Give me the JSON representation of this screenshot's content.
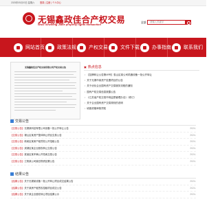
{
  "topbar": {
    "date": "2025年05月03日 星期六",
    "login": "登录 | 注册 | 个人中心"
  },
  "header": {
    "logo_title": "无锡鑫政佳合产权交易",
    "logo_subtitle": "Wuxi Xinzheng Jiahe property rights transaction",
    "search_label": "全部",
    "search_placeholder": "请输入关键字"
  },
  "nav": {
    "items": [
      {
        "label": "网站首页",
        "icon": "home-icon"
      },
      {
        "label": "政策法规",
        "icon": "document-icon"
      },
      {
        "label": "产权交易",
        "icon": "exchange-icon"
      },
      {
        "label": "文件下载",
        "icon": "download-icon"
      },
      {
        "label": "办事指南",
        "icon": "guide-icon"
      },
      {
        "label": "联系我们",
        "icon": "contact-icon"
      }
    ]
  },
  "feature": {
    "heading": "无锡鑫政佳合产权交易有限公司产权交易公告"
  },
  "hot": {
    "title": "热点信息",
    "items": [
      "【挂牌转让公告第49号】惠山区某公司机器设备一批公开转让",
      "关于无锡市某资产处置项目的公告",
      "关于优化企业国有资产交易服务流程的通知",
      "国有产权交易信息披露公告",
      "《江苏省产权交易市场监督管理办法》（修订）",
      "关于企业国有资产交易规则的说明",
      "填报资格审核须知"
    ]
  },
  "sections": [
    {
      "title": "交易公告",
      "rows": [
        {
          "tag": "【交易公告】",
          "title": "无锡某科技有限公司设备一批公开转让公告",
          "date": "2024-"
        },
        {
          "tag": "【交易公告】",
          "title": "锡山区某资产整体转让项目交易公告",
          "date": "2024-"
        },
        {
          "tag": "【交易公告】",
          "title": "新吴区某房产租赁权公开招租公告",
          "date": "2024-"
        },
        {
          "tag": "【交易公告】",
          "title": "滨湖区某企业股权转让交易公告",
          "date": "2024-"
        },
        {
          "tag": "【交易公告】",
          "title": "梁溪区某车辆公开拍卖交易公告",
          "date": "2024-"
        },
        {
          "tag": "【交易公告】",
          "title": "江阴某公司废旧物资处置公告",
          "date": "2024-"
        }
      ]
    },
    {
      "title": "结果公告",
      "rows": [
        {
          "tag": "【结果公告】",
          "title": "关于无锡某设备一批公开转让项目成交结果公告",
          "date": "2024-"
        },
        {
          "tag": "【结果公告】",
          "title": "关于某房产租赁权招租项目成交公告",
          "date": "2024-"
        },
        {
          "tag": "【结果公告】",
          "title": "关于某企业股权转让项目结果公示",
          "date": "2024-"
        }
      ]
    }
  ],
  "colors": {
    "brand": "#c8161d",
    "section_icon": "#3a7fd5"
  }
}
